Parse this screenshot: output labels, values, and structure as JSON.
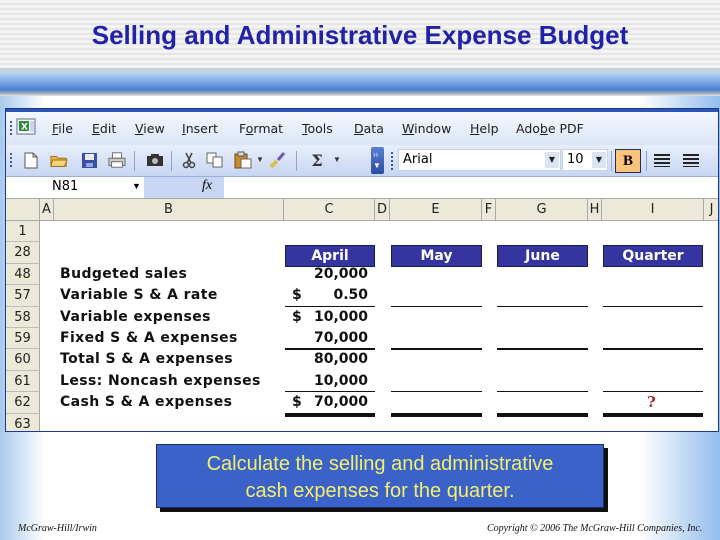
{
  "slide": {
    "title": "Selling and Administrative Expense Budget",
    "callout_line1": "Calculate the selling and administrative",
    "callout_line2": "cash expenses for the quarter.",
    "footer_left": "McGraw-Hill/Irwin",
    "footer_right": "Copyright © 2006 The McGraw-Hill Companies, Inc."
  },
  "excel": {
    "menu": [
      "File",
      "Edit",
      "View",
      "Insert",
      "Format",
      "Tools",
      "Data",
      "Window",
      "Help",
      "Adobe PDF"
    ],
    "menu_underline": [
      "F",
      "E",
      "V",
      "I",
      "o",
      "T",
      "D",
      "W",
      "H",
      "b"
    ],
    "toolbar": {
      "icons": [
        "new-icon",
        "open-icon",
        "save-icon",
        "print-preview-icon",
        "camera-icon",
        "cut-icon",
        "copy-icon",
        "paste-icon",
        "format-painter-icon",
        "autosum-icon"
      ],
      "font_name": "Arial",
      "font_size": "10",
      "bold_label": "B",
      "bold_active": true,
      "autosum_glyph": "Σ"
    },
    "name_box": "N81",
    "fx_label": "fx",
    "formula_value": "",
    "columns": [
      "A",
      "B",
      "C",
      "D",
      "E",
      "F",
      "G",
      "H",
      "I",
      "J"
    ],
    "rows": [
      "1",
      "28",
      "48",
      "57",
      "58",
      "59",
      "60",
      "61",
      "62",
      "63"
    ],
    "month_headers": [
      "April",
      "May",
      "June",
      "Quarter"
    ],
    "line_items": [
      {
        "row": "48",
        "label": "Budgeted sales",
        "april": "20,000",
        "dollar": false
      },
      {
        "row": "57",
        "label": "Variable S & A rate",
        "april": "0.50",
        "dollar": true
      },
      {
        "row": "58",
        "label": "Variable expenses",
        "april": "10,000",
        "dollar": true
      },
      {
        "row": "59",
        "label": "Fixed S & A expenses",
        "april": "70,000",
        "dollar": false
      },
      {
        "row": "60",
        "label": "Total S & A expenses",
        "april": "80,000",
        "dollar": false
      },
      {
        "row": "61",
        "label": "Less: Noncash expenses",
        "april": "10,000",
        "dollar": false
      },
      {
        "row": "62",
        "label": "Cash S & A expenses",
        "april": "70,000",
        "dollar": true
      }
    ],
    "dollar_sign": "$",
    "quarter_cash_placeholder": "?",
    "accent_header_color": "#3535a0",
    "question_color": "#a52a2a"
  }
}
